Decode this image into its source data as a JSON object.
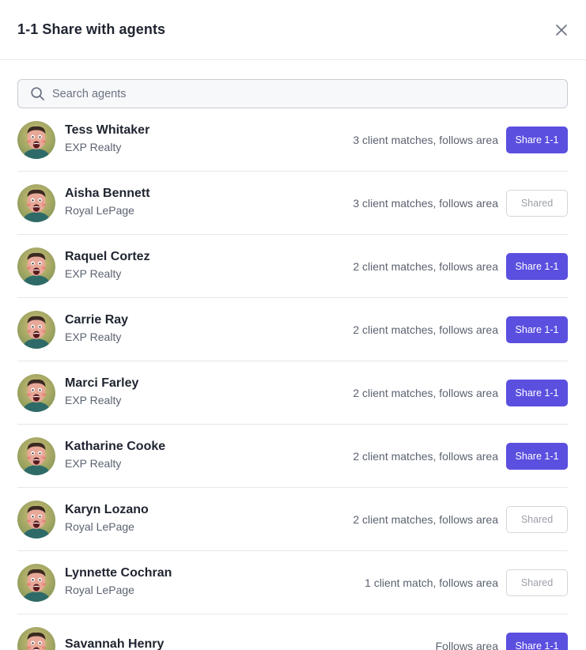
{
  "modal": {
    "title": "1-1 Share with agents",
    "close_icon": "close-icon"
  },
  "search": {
    "placeholder": "Search agents",
    "value": "",
    "icon": "search-icon"
  },
  "agents": [
    {
      "name": "Tess Whitaker",
      "company": "EXP Realty",
      "matches": "3 client matches, follows area",
      "action": "Share 1-1",
      "shared": false
    },
    {
      "name": "Aisha Bennett",
      "company": "Royal LePage",
      "matches": "3 client matches, follows area",
      "action": "Shared",
      "shared": true
    },
    {
      "name": "Raquel Cortez",
      "company": "EXP Realty",
      "matches": "2 client matches, follows area",
      "action": "Share 1-1",
      "shared": false
    },
    {
      "name": "Carrie Ray",
      "company": "EXP Realty",
      "matches": "2 client matches, follows area",
      "action": "Share 1-1",
      "shared": false
    },
    {
      "name": "Marci Farley",
      "company": "EXP Realty",
      "matches": "2 client matches, follows area",
      "action": "Share 1-1",
      "shared": false
    },
    {
      "name": "Katharine Cooke",
      "company": "EXP Realty",
      "matches": "2 client matches, follows area",
      "action": "Share 1-1",
      "shared": false
    },
    {
      "name": "Karyn Lozano",
      "company": "Royal LePage",
      "matches": "2 client matches, follows area",
      "action": "Shared",
      "shared": true
    },
    {
      "name": "Lynnette Cochran",
      "company": "Royal LePage",
      "matches": "1 client match, follows area",
      "action": "Shared",
      "shared": true
    },
    {
      "name": "Savannah Henry",
      "company": "",
      "matches": "Follows area",
      "action": "Share 1-1",
      "shared": false
    }
  ],
  "colors": {
    "primary": "#5b4fe0",
    "text": "#1f2430",
    "muted": "#5b6270",
    "border": "#e6e7eb"
  }
}
